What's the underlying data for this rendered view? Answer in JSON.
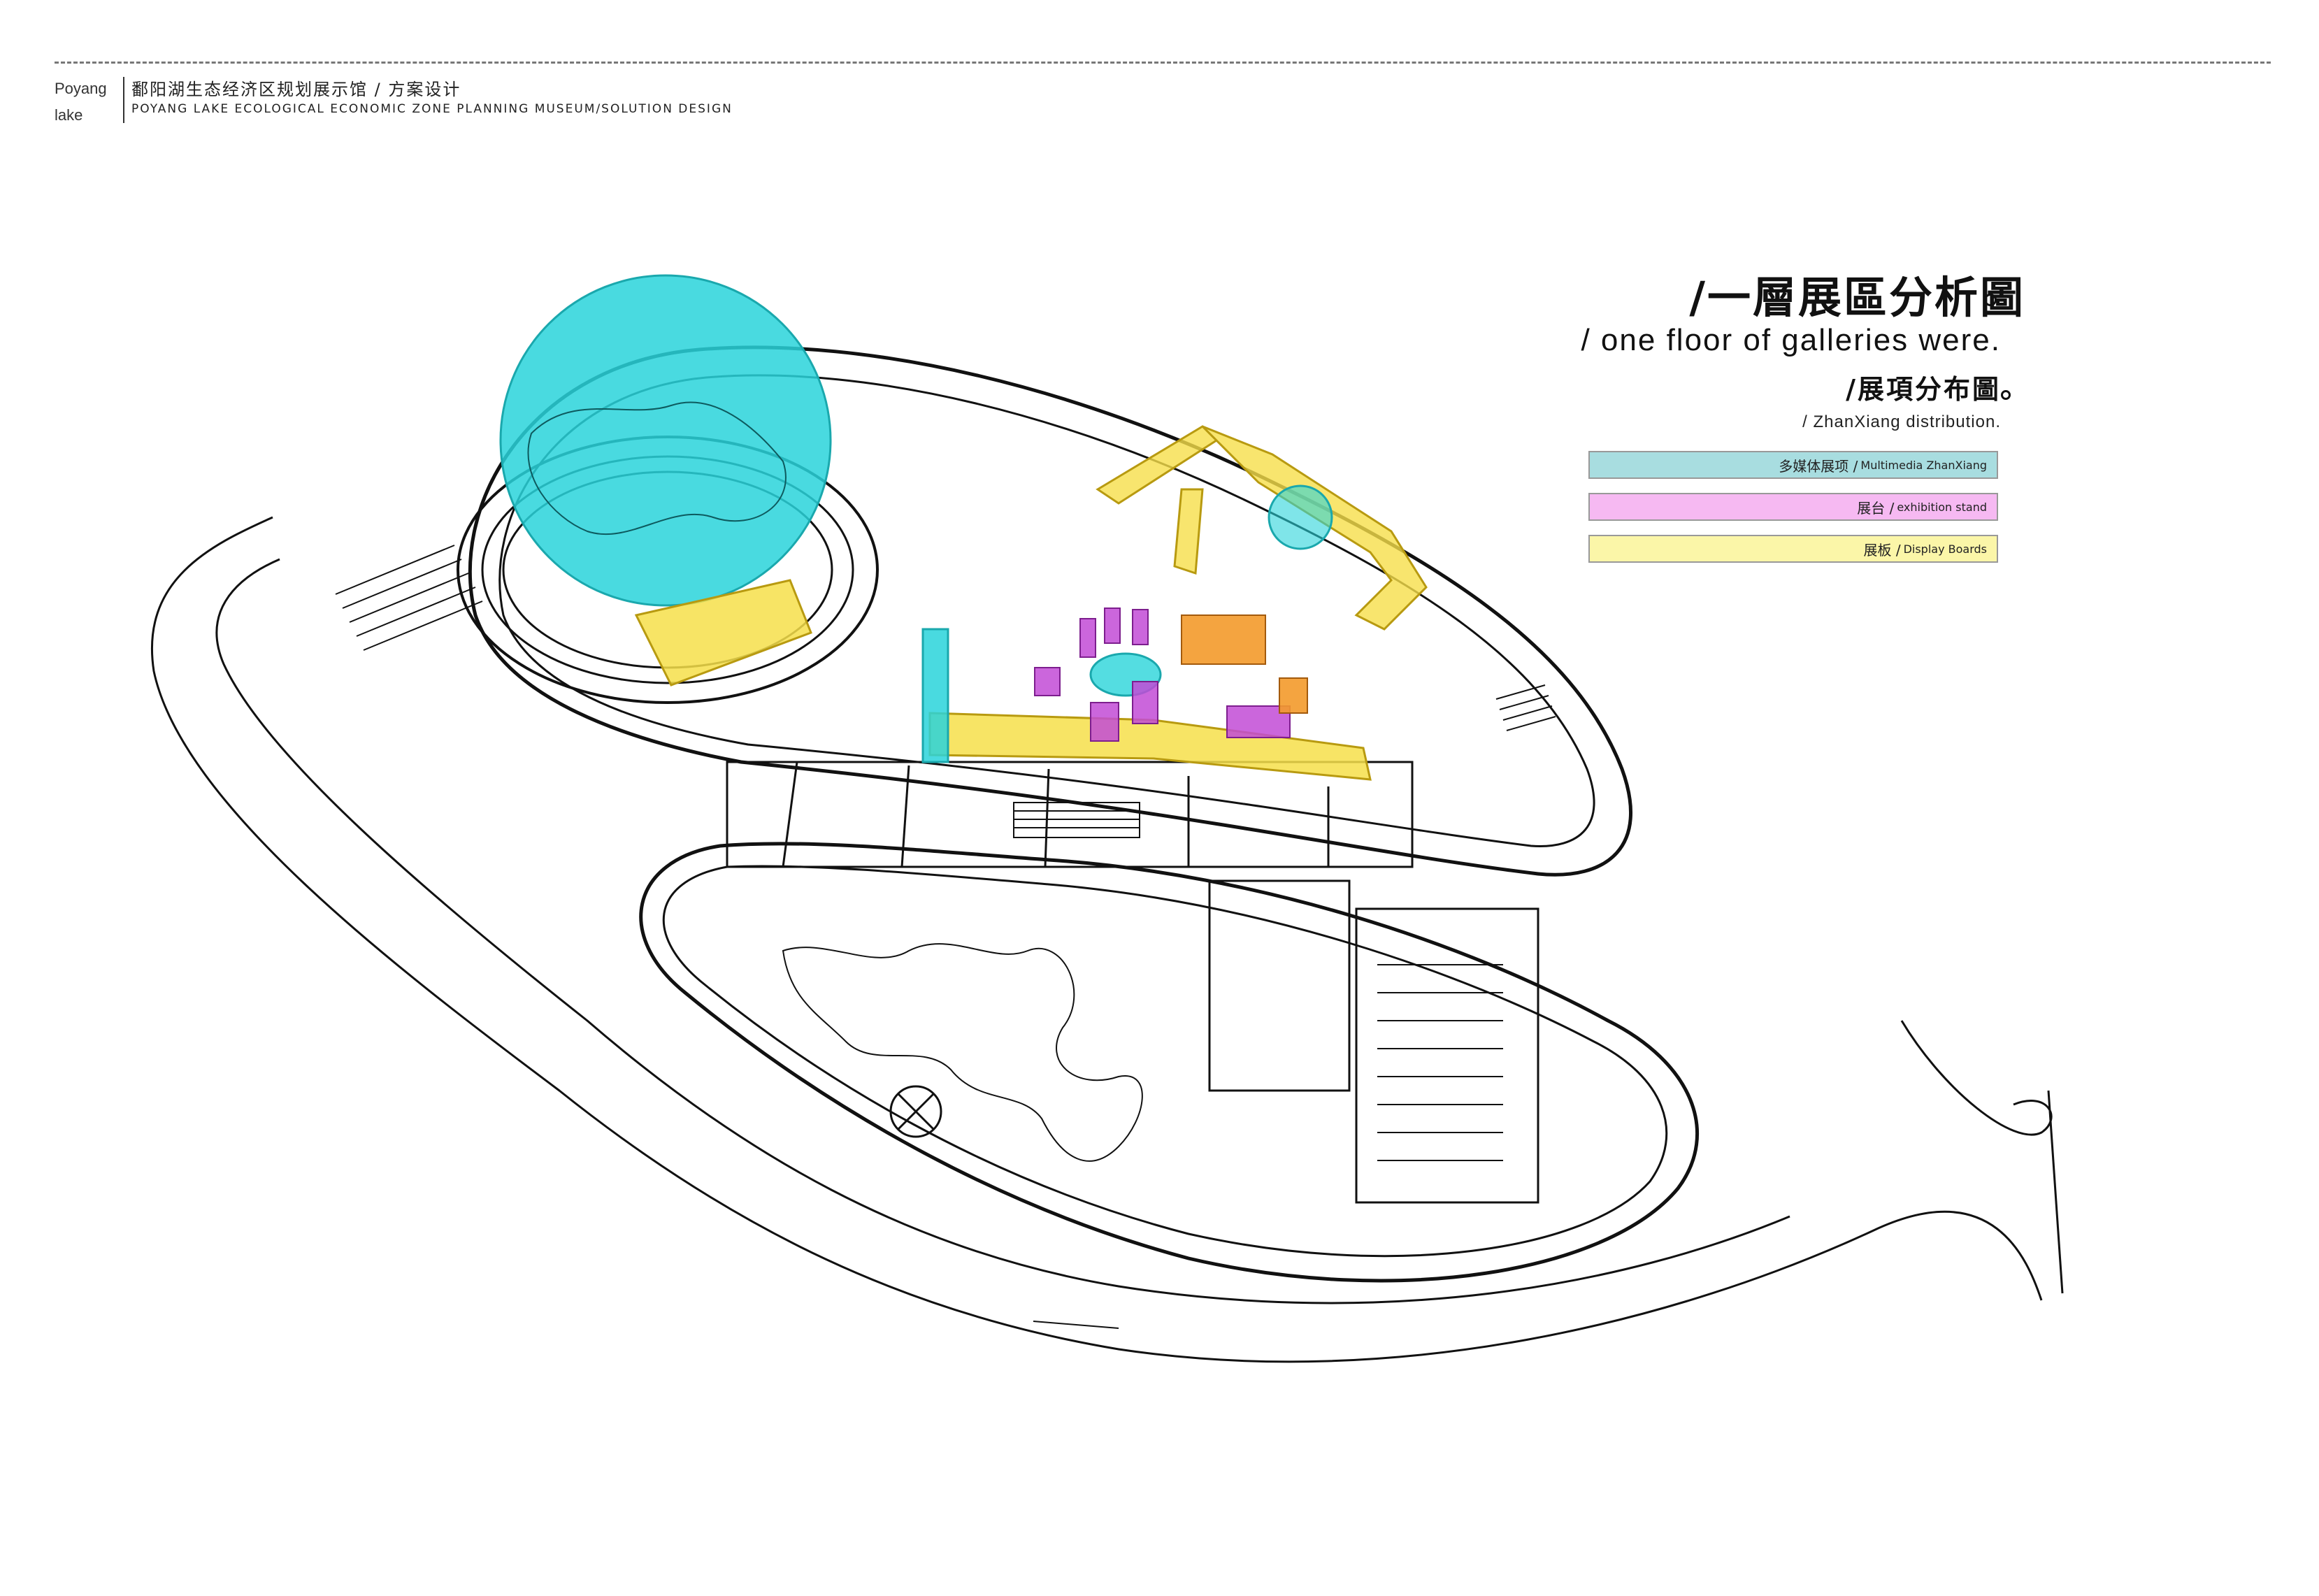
{
  "header": {
    "brand_line1": "Poyang",
    "brand_line2": "lake",
    "title_cn": "鄱阳湖生态经济区规划展示馆 / 方案设计",
    "title_en": "POYANG LAKE ECOLOGICAL ECONOMIC ZONE PLANNING MUSEUM/SOLUTION DESIGN"
  },
  "heading": {
    "main": "/一層展區分析圖",
    "en1": "/ one floor of galleries were.",
    "sub": "/展項分布圖",
    "en2": "/ ZhanXiang distribution."
  },
  "legend": [
    {
      "cn": "多媒体展项 /",
      "en": "Multimedia ZhanXiang",
      "color": "#a8dde0"
    },
    {
      "cn": "展台 /",
      "en": "exhibition stand",
      "color": "#f6b9f2"
    },
    {
      "cn": "展板 /",
      "en": "Display Boards",
      "color": "#fbf6a8"
    }
  ],
  "colors": {
    "multimedia": "#29d4da",
    "stand": "#c24bd6",
    "boards": "#f6df4a",
    "stand_orange": "#f39a2b",
    "linework": "#111111"
  }
}
